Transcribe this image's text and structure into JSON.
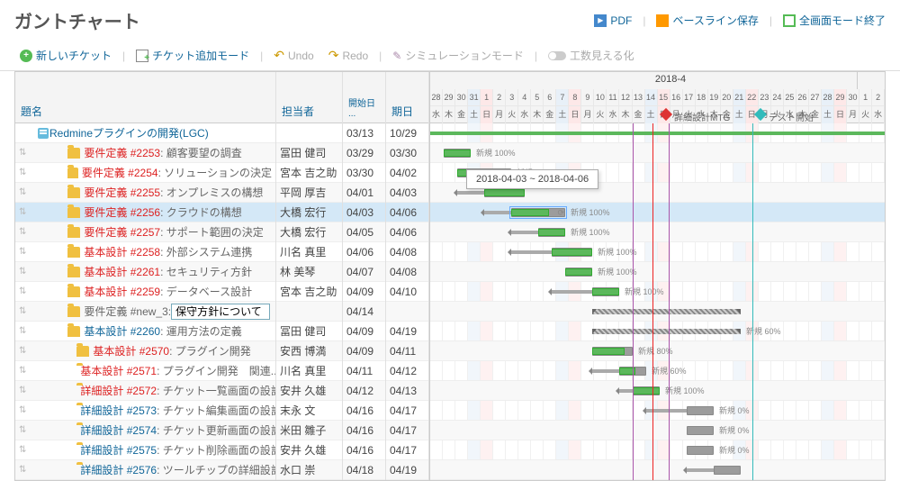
{
  "page": {
    "title": "ガントチャート"
  },
  "header_actions": {
    "pdf": "PDF",
    "baseline": "ベースライン保存",
    "fullscreen_exit": "全画面モード終了"
  },
  "toolbar": {
    "new_ticket": "新しいチケット",
    "add_ticket_mode": "チケット追加モード",
    "undo": "Undo",
    "redo": "Redo",
    "simulation": "シミュレーションモード",
    "effort": "工数見える化"
  },
  "columns": {
    "subject": "題名",
    "assignee": "担当者",
    "start": "開始日 ...",
    "due": "期日"
  },
  "timeline": {
    "month_label": "2018-4",
    "start_date": "2018-03-28",
    "milestones": [
      {
        "date": "2018-04-14",
        "label": "詳細設計MTG",
        "color": "red"
      },
      {
        "date": "2018-04-21",
        "label": "テスト開始",
        "color": "teal"
      }
    ],
    "today": "2018-04-13",
    "tooltip": "2018-04-03 ~ 2018-04-06"
  },
  "rows": [
    {
      "type": "project",
      "subject": "Redmineプラグインの開発(LGC)",
      "start": "03/13",
      "due": "10/29"
    },
    {
      "type": "task",
      "indent": 1,
      "tracker": "要件定義",
      "tclass": "red",
      "num": "#2253",
      "subject": "顧客要望の調査",
      "assignee": "冨田 健司",
      "start": "03/29",
      "due": "03/30",
      "bar_start": 1,
      "bar_len": 2,
      "done": 100,
      "lead": 0,
      "label": "新規 100%"
    },
    {
      "type": "task",
      "indent": 1,
      "tracker": "要件定義",
      "tclass": "red",
      "num": "#2254",
      "subject": "ソリューションの決定",
      "assignee": "宮本 吉之助",
      "start": "03/30",
      "due": "04/02",
      "bar_start": 2,
      "bar_len": 4,
      "done": 100,
      "lead": 0,
      "label": "新規 100%"
    },
    {
      "type": "task",
      "indent": 1,
      "tracker": "要件定義",
      "tclass": "red",
      "num": "#2255",
      "subject": "オンプレミスの構想",
      "assignee": "平岡 厚吉",
      "start": "04/01",
      "due": "04/03",
      "bar_start": 4,
      "bar_len": 3,
      "done": 100,
      "lead": 2,
      "label": ""
    },
    {
      "type": "task",
      "indent": 1,
      "tracker": "要件定義",
      "tclass": "red",
      "num": "#2256",
      "subject": "クラウドの構想",
      "assignee": "大橋 宏行",
      "start": "04/03",
      "due": "04/06",
      "bar_start": 6,
      "bar_len": 4,
      "done": 70,
      "lead": 2,
      "label": "新規 100%",
      "selected": true,
      "highlight": true
    },
    {
      "type": "task",
      "indent": 1,
      "tracker": "要件定義",
      "tclass": "red",
      "num": "#2257",
      "subject": "サポート範囲の決定",
      "assignee": "大橋 宏行",
      "start": "04/05",
      "due": "04/06",
      "bar_start": 8,
      "bar_len": 2,
      "done": 100,
      "lead": 2,
      "label": "新規 100%"
    },
    {
      "type": "task",
      "indent": 1,
      "tracker": "基本設計",
      "tclass": "red",
      "num": "#2258",
      "subject": "外部システム連携",
      "assignee": "川名 真里",
      "start": "04/06",
      "due": "04/08",
      "bar_start": 9,
      "bar_len": 3,
      "done": 100,
      "lead": 3,
      "label": "新規 100%"
    },
    {
      "type": "task",
      "indent": 1,
      "tracker": "基本設計",
      "tclass": "red",
      "num": "#2261",
      "subject": "セキュリティ方針",
      "assignee": "林 美琴",
      "start": "04/07",
      "due": "04/08",
      "bar_start": 10,
      "bar_len": 2,
      "done": 100,
      "lead": 0,
      "label": "新規 100%"
    },
    {
      "type": "task",
      "indent": 1,
      "tracker": "基本設計",
      "tclass": "red",
      "num": "#2259",
      "subject": "データベース設計",
      "assignee": "宮本 吉之助",
      "start": "04/09",
      "due": "04/10",
      "bar_start": 12,
      "bar_len": 2,
      "done": 100,
      "lead": 3,
      "label": "新規 100%"
    },
    {
      "type": "edit",
      "indent": 1,
      "tracker": "要件定義",
      "tclass": "",
      "num": "#new_3",
      "subject_value": "保守方針について",
      "start": "04/14",
      "due": "",
      "bar_start": 12,
      "bar_len": 11,
      "parent": true
    },
    {
      "type": "task",
      "indent": 1,
      "tracker": "基本設計",
      "tclass": "blue",
      "num": "#2260",
      "subject": "運用方法の定義",
      "assignee": "冨田 健司",
      "start": "04/09",
      "due": "04/19",
      "bar_start": 12,
      "bar_len": 11,
      "done": 60,
      "lead": 0,
      "parent": true,
      "label": "新規 60%"
    },
    {
      "type": "task",
      "indent": 2,
      "tracker": "基本設計",
      "tclass": "red",
      "num": "#2570",
      "subject": "プラグイン開発",
      "assignee": "安西 博満",
      "start": "04/09",
      "due": "04/11",
      "bar_start": 12,
      "bar_len": 3,
      "done": 80,
      "lead": 0,
      "label": "新規 80%"
    },
    {
      "type": "task",
      "indent": 2,
      "tracker": "基本設計",
      "tclass": "red",
      "num": "#2571",
      "subject": "プラグイン開発　関連...",
      "assignee": "川名 真里",
      "start": "04/11",
      "due": "04/12",
      "bar_start": 14,
      "bar_len": 2,
      "done": 60,
      "lead": 2,
      "label": "新規 60%"
    },
    {
      "type": "task",
      "indent": 2,
      "tracker": "詳細設計",
      "tclass": "red",
      "num": "#2572",
      "subject": "チケット一覧画面の設計",
      "assignee": "安井 久雄",
      "start": "04/12",
      "due": "04/13",
      "bar_start": 15,
      "bar_len": 2,
      "done": 100,
      "lead": 1,
      "label": "新規 100%"
    },
    {
      "type": "task",
      "indent": 2,
      "tracker": "詳細設計",
      "tclass": "blue",
      "num": "#2573",
      "subject": "チケット編集画面の設計",
      "assignee": "末永 文",
      "start": "04/16",
      "due": "04/17",
      "bar_start": 19,
      "bar_len": 2,
      "done": 0,
      "lead": 3,
      "label": "新規 0%"
    },
    {
      "type": "task",
      "indent": 2,
      "tracker": "詳細設計",
      "tclass": "blue",
      "num": "#2574",
      "subject": "チケット更新画面の設計",
      "assignee": "米田 雛子",
      "start": "04/16",
      "due": "04/17",
      "bar_start": 19,
      "bar_len": 2,
      "done": 0,
      "lead": 0,
      "label": "新規 0%"
    },
    {
      "type": "task",
      "indent": 2,
      "tracker": "詳細設計",
      "tclass": "blue",
      "num": "#2575",
      "subject": "チケット削除画面の設計",
      "assignee": "安井 久雄",
      "start": "04/16",
      "due": "04/17",
      "bar_start": 19,
      "bar_len": 2,
      "done": 0,
      "lead": 0,
      "label": "新規 0%"
    },
    {
      "type": "task",
      "indent": 2,
      "tracker": "詳細設計",
      "tclass": "blue",
      "num": "#2576",
      "subject": "ツールチップの詳細設計",
      "assignee": "水口 崇",
      "start": "04/18",
      "due": "04/19",
      "bar_start": 21,
      "bar_len": 2,
      "done": 0,
      "lead": 2,
      "label": ""
    }
  ],
  "days": [
    {
      "n": "28",
      "w": "水"
    },
    {
      "n": "29",
      "w": "木"
    },
    {
      "n": "30",
      "w": "金"
    },
    {
      "n": "31",
      "w": "土",
      "c": "sat"
    },
    {
      "n": "1",
      "w": "日",
      "c": "sun"
    },
    {
      "n": "2",
      "w": "月"
    },
    {
      "n": "3",
      "w": "火"
    },
    {
      "n": "4",
      "w": "水"
    },
    {
      "n": "5",
      "w": "木"
    },
    {
      "n": "6",
      "w": "金"
    },
    {
      "n": "7",
      "w": "土",
      "c": "sat"
    },
    {
      "n": "8",
      "w": "日",
      "c": "sun"
    },
    {
      "n": "9",
      "w": "月"
    },
    {
      "n": "10",
      "w": "火"
    },
    {
      "n": "11",
      "w": "水"
    },
    {
      "n": "12",
      "w": "木"
    },
    {
      "n": "13",
      "w": "金"
    },
    {
      "n": "14",
      "w": "土",
      "c": "sat"
    },
    {
      "n": "15",
      "w": "日",
      "c": "sun"
    },
    {
      "n": "16",
      "w": "月"
    },
    {
      "n": "17",
      "w": "火"
    },
    {
      "n": "18",
      "w": "水"
    },
    {
      "n": "19",
      "w": "木"
    },
    {
      "n": "20",
      "w": "金"
    },
    {
      "n": "21",
      "w": "土",
      "c": "sat"
    },
    {
      "n": "22",
      "w": "日",
      "c": "sun"
    },
    {
      "n": "23",
      "w": "月"
    },
    {
      "n": "24",
      "w": "火"
    },
    {
      "n": "25",
      "w": "水"
    },
    {
      "n": "26",
      "w": "木"
    },
    {
      "n": "27",
      "w": "金"
    },
    {
      "n": "28",
      "w": "土",
      "c": "sat"
    },
    {
      "n": "29",
      "w": "日",
      "c": "sun"
    },
    {
      "n": "30",
      "w": "月"
    },
    {
      "n": "1",
      "w": "火"
    },
    {
      "n": "2",
      "w": "水"
    }
  ]
}
